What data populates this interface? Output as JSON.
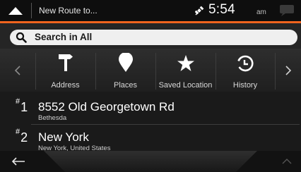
{
  "header": {
    "title": "New Route to...",
    "time": "5:54",
    "ampm": "am",
    "icons": [
      "menu-icon",
      "satellite-icon",
      "message-icon"
    ],
    "accent_color": "#f0641e"
  },
  "search": {
    "label": "Search in All",
    "icon": "search-icon"
  },
  "categories": [
    {
      "label": "Address",
      "icon": "signpost-icon"
    },
    {
      "label": "Places",
      "icon": "pin-icon"
    },
    {
      "label": "Saved Location",
      "icon": "star-icon"
    },
    {
      "label": "History",
      "icon": "history-icon"
    }
  ],
  "results": [
    {
      "rank": "#",
      "index": "1",
      "title": "8552 Old Georgetown Rd",
      "subtitle": "Bethesda"
    },
    {
      "rank": "#",
      "index": "2",
      "title": "New York",
      "subtitle": "New York, United States"
    }
  ],
  "footer": {
    "icons": [
      "back-arrow-icon",
      "chevron-up-icon"
    ]
  }
}
